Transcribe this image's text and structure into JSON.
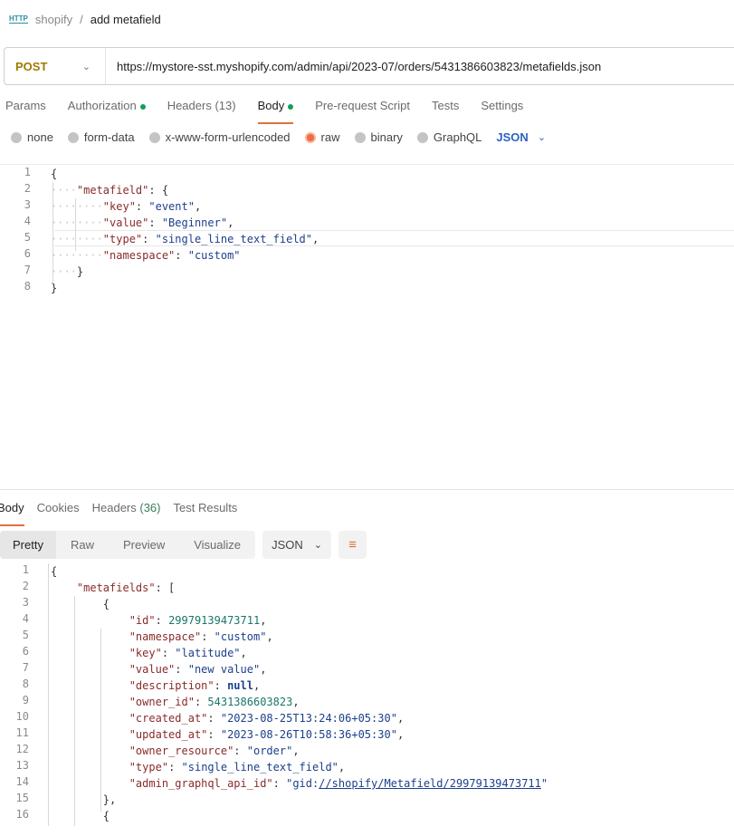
{
  "header": {
    "icon": "HTTP",
    "collection": "shopify",
    "separator": "/",
    "request_name": "add metafield"
  },
  "request": {
    "method": "POST",
    "url": "https://mystore-sst.myshopify.com/admin/api/2023-07/orders/5431386603823/metafields.json"
  },
  "request_tabs": [
    {
      "label": "Params"
    },
    {
      "label": "Authorization",
      "dot": true
    },
    {
      "label": "Headers",
      "count": "(13)"
    },
    {
      "label": "Body",
      "dot": true,
      "active": true
    },
    {
      "label": "Pre-request Script"
    },
    {
      "label": "Tests"
    },
    {
      "label": "Settings"
    }
  ],
  "body_types": [
    {
      "label": "none"
    },
    {
      "label": "form-data"
    },
    {
      "label": "x-www-form-urlencoded"
    },
    {
      "label": "raw",
      "selected": true
    },
    {
      "label": "binary"
    },
    {
      "label": "GraphQL"
    }
  ],
  "body_format": "JSON",
  "request_body": [
    [
      [
        "p",
        "{"
      ]
    ],
    [
      [
        "ws",
        "····"
      ],
      [
        "k",
        "\"metafield\""
      ],
      [
        "p",
        ": {"
      ]
    ],
    [
      [
        "ws",
        "········"
      ],
      [
        "k",
        "\"key\""
      ],
      [
        "p",
        ": "
      ],
      [
        "s",
        "\"event\""
      ],
      [
        "p",
        ","
      ]
    ],
    [
      [
        "ws",
        "········"
      ],
      [
        "k",
        "\"value\""
      ],
      [
        "p",
        ": "
      ],
      [
        "s",
        "\"Beginner\""
      ],
      [
        "p",
        ","
      ]
    ],
    [
      [
        "ws",
        "········"
      ],
      [
        "k",
        "\"type\""
      ],
      [
        "p",
        ": "
      ],
      [
        "s",
        "\"single_line_text_field\""
      ],
      [
        "p",
        ","
      ]
    ],
    [
      [
        "ws",
        "········"
      ],
      [
        "k",
        "\"namespace\""
      ],
      [
        "p",
        ": "
      ],
      [
        "s",
        "\"custom\""
      ]
    ],
    [
      [
        "ws",
        "····"
      ],
      [
        "p",
        "}"
      ]
    ],
    [
      [
        "p",
        "}"
      ]
    ]
  ],
  "response_tabs": [
    {
      "label": "Body",
      "active": true
    },
    {
      "label": "Cookies"
    },
    {
      "label": "Headers",
      "count": "(36)"
    },
    {
      "label": "Test Results"
    }
  ],
  "response_views": [
    "Pretty",
    "Raw",
    "Preview",
    "Visualize"
  ],
  "response_format": "JSON",
  "response_body": [
    [
      [
        "p",
        "{"
      ]
    ],
    [
      [
        "ws",
        "    "
      ],
      [
        "k",
        "\"metafields\""
      ],
      [
        "p",
        ": ["
      ]
    ],
    [
      [
        "ws",
        "        "
      ],
      [
        "p",
        "{"
      ]
    ],
    [
      [
        "ws",
        "            "
      ],
      [
        "k",
        "\"id\""
      ],
      [
        "p",
        ": "
      ],
      [
        "n",
        "29979139473711"
      ],
      [
        "p",
        ","
      ]
    ],
    [
      [
        "ws",
        "            "
      ],
      [
        "k",
        "\"namespace\""
      ],
      [
        "p",
        ": "
      ],
      [
        "s",
        "\"custom\""
      ],
      [
        "p",
        ","
      ]
    ],
    [
      [
        "ws",
        "            "
      ],
      [
        "k",
        "\"key\""
      ],
      [
        "p",
        ": "
      ],
      [
        "s",
        "\"latitude\""
      ],
      [
        "p",
        ","
      ]
    ],
    [
      [
        "ws",
        "            "
      ],
      [
        "k",
        "\"value\""
      ],
      [
        "p",
        ": "
      ],
      [
        "s",
        "\"new value\""
      ],
      [
        "p",
        ","
      ]
    ],
    [
      [
        "ws",
        "            "
      ],
      [
        "k",
        "\"description\""
      ],
      [
        "p",
        ": "
      ],
      [
        "b",
        "null"
      ],
      [
        "p",
        ","
      ]
    ],
    [
      [
        "ws",
        "            "
      ],
      [
        "k",
        "\"owner_id\""
      ],
      [
        "p",
        ": "
      ],
      [
        "n",
        "5431386603823"
      ],
      [
        "p",
        ","
      ]
    ],
    [
      [
        "ws",
        "            "
      ],
      [
        "k",
        "\"created_at\""
      ],
      [
        "p",
        ": "
      ],
      [
        "s",
        "\"2023-08-25T13:24:06+05:30\""
      ],
      [
        "p",
        ","
      ]
    ],
    [
      [
        "ws",
        "            "
      ],
      [
        "k",
        "\"updated_at\""
      ],
      [
        "p",
        ": "
      ],
      [
        "s",
        "\"2023-08-26T10:58:36+05:30\""
      ],
      [
        "p",
        ","
      ]
    ],
    [
      [
        "ws",
        "            "
      ],
      [
        "k",
        "\"owner_resource\""
      ],
      [
        "p",
        ": "
      ],
      [
        "s",
        "\"order\""
      ],
      [
        "p",
        ","
      ]
    ],
    [
      [
        "ws",
        "            "
      ],
      [
        "k",
        "\"type\""
      ],
      [
        "p",
        ": "
      ],
      [
        "s",
        "\"single_line_text_field\""
      ],
      [
        "p",
        ","
      ]
    ],
    [
      [
        "ws",
        "            "
      ],
      [
        "k",
        "\"admin_graphql_api_id\""
      ],
      [
        "p",
        ": "
      ],
      [
        "s",
        "\"gid:"
      ],
      [
        "u",
        "//shopify/Metafield/29979139473711"
      ],
      [
        "s",
        "\""
      ]
    ],
    [
      [
        "ws",
        "        "
      ],
      [
        "p",
        "},"
      ]
    ],
    [
      [
        "ws",
        "        "
      ],
      [
        "p",
        "{"
      ]
    ]
  ]
}
